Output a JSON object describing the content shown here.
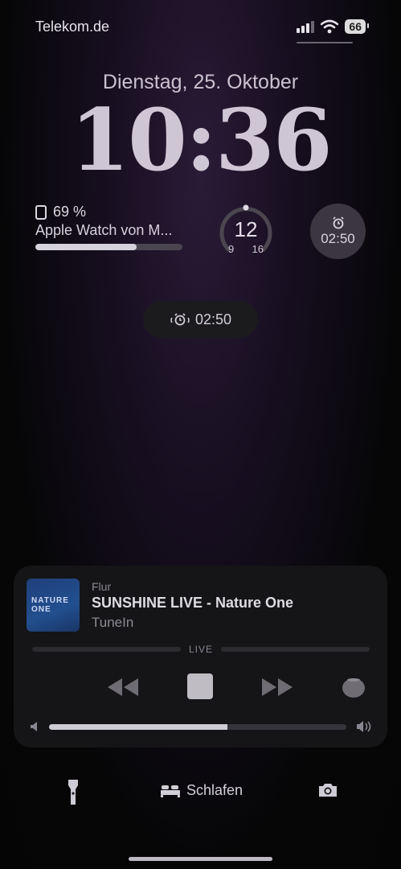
{
  "status": {
    "carrier": "Telekom.de",
    "battery": "66"
  },
  "lock": {
    "date": "Dienstag, 25. Oktober",
    "time": "10:36"
  },
  "widgets": {
    "watch": {
      "percent": "69 %",
      "name": "Apple Watch von M...",
      "level": 0.69
    },
    "temperature": {
      "current": "12",
      "min": "9",
      "max": "16"
    },
    "alarm": {
      "time": "02:50"
    }
  },
  "alarm_pill": {
    "time": "02:50"
  },
  "player": {
    "room": "Flur",
    "title": "SUNSHINE LIVE - Nature One",
    "source": "TuneIn",
    "live_label": "LIVE",
    "volume_level": 0.6,
    "art_text": "NATURE ONE"
  },
  "bottom": {
    "sleep_label": "Schlafen"
  },
  "icons": [
    "signal-icon",
    "wifi-icon",
    "watch-icon",
    "alarm-icon",
    "rewind-icon",
    "stop-icon",
    "forward-icon",
    "homepod-icon",
    "volume-low-icon",
    "volume-high-icon",
    "flashlight-icon",
    "bed-icon",
    "camera-icon"
  ]
}
